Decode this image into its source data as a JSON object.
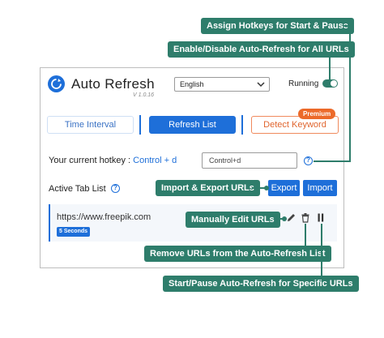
{
  "header": {
    "app_title": "Auto Refresh",
    "version": "V 1.0.16",
    "language": "English",
    "running_label": "Running",
    "running_on": true
  },
  "tabs": [
    {
      "label": "Time Interval"
    },
    {
      "label": "Refresh List"
    },
    {
      "label": "Detect Keyword"
    }
  ],
  "premium_badge": "Premium",
  "hotkey": {
    "label": "Your current hotkey : ",
    "value": "Control + d",
    "input_value": "Control+d"
  },
  "active_tab": {
    "label": "Active Tab List",
    "export_label": "Export",
    "import_label": "Import"
  },
  "url_entry": {
    "url": "https://www.freepik.com",
    "interval": "5 Seconds"
  },
  "callouts": {
    "hotkeys": "Assign Hotkeys for Start & Pause",
    "auto_refresh": "Enable/Disable Auto-Refresh for All URLs",
    "import_export": "Import & Export URLs",
    "edit": "Manually Edit URLs",
    "remove": "Remove URLs from the Auto-Refresh List",
    "start_pause": "Start/Pause Auto-Refresh for Specific URLs"
  },
  "colors": {
    "accent": "#1e6fd9",
    "callout": "#2e7d6b",
    "premium": "#ec6a2a"
  },
  "icons": [
    "refresh-logo-icon",
    "chevron-down-icon",
    "help-icon",
    "pencil-icon",
    "trash-icon",
    "pause-icon"
  ]
}
